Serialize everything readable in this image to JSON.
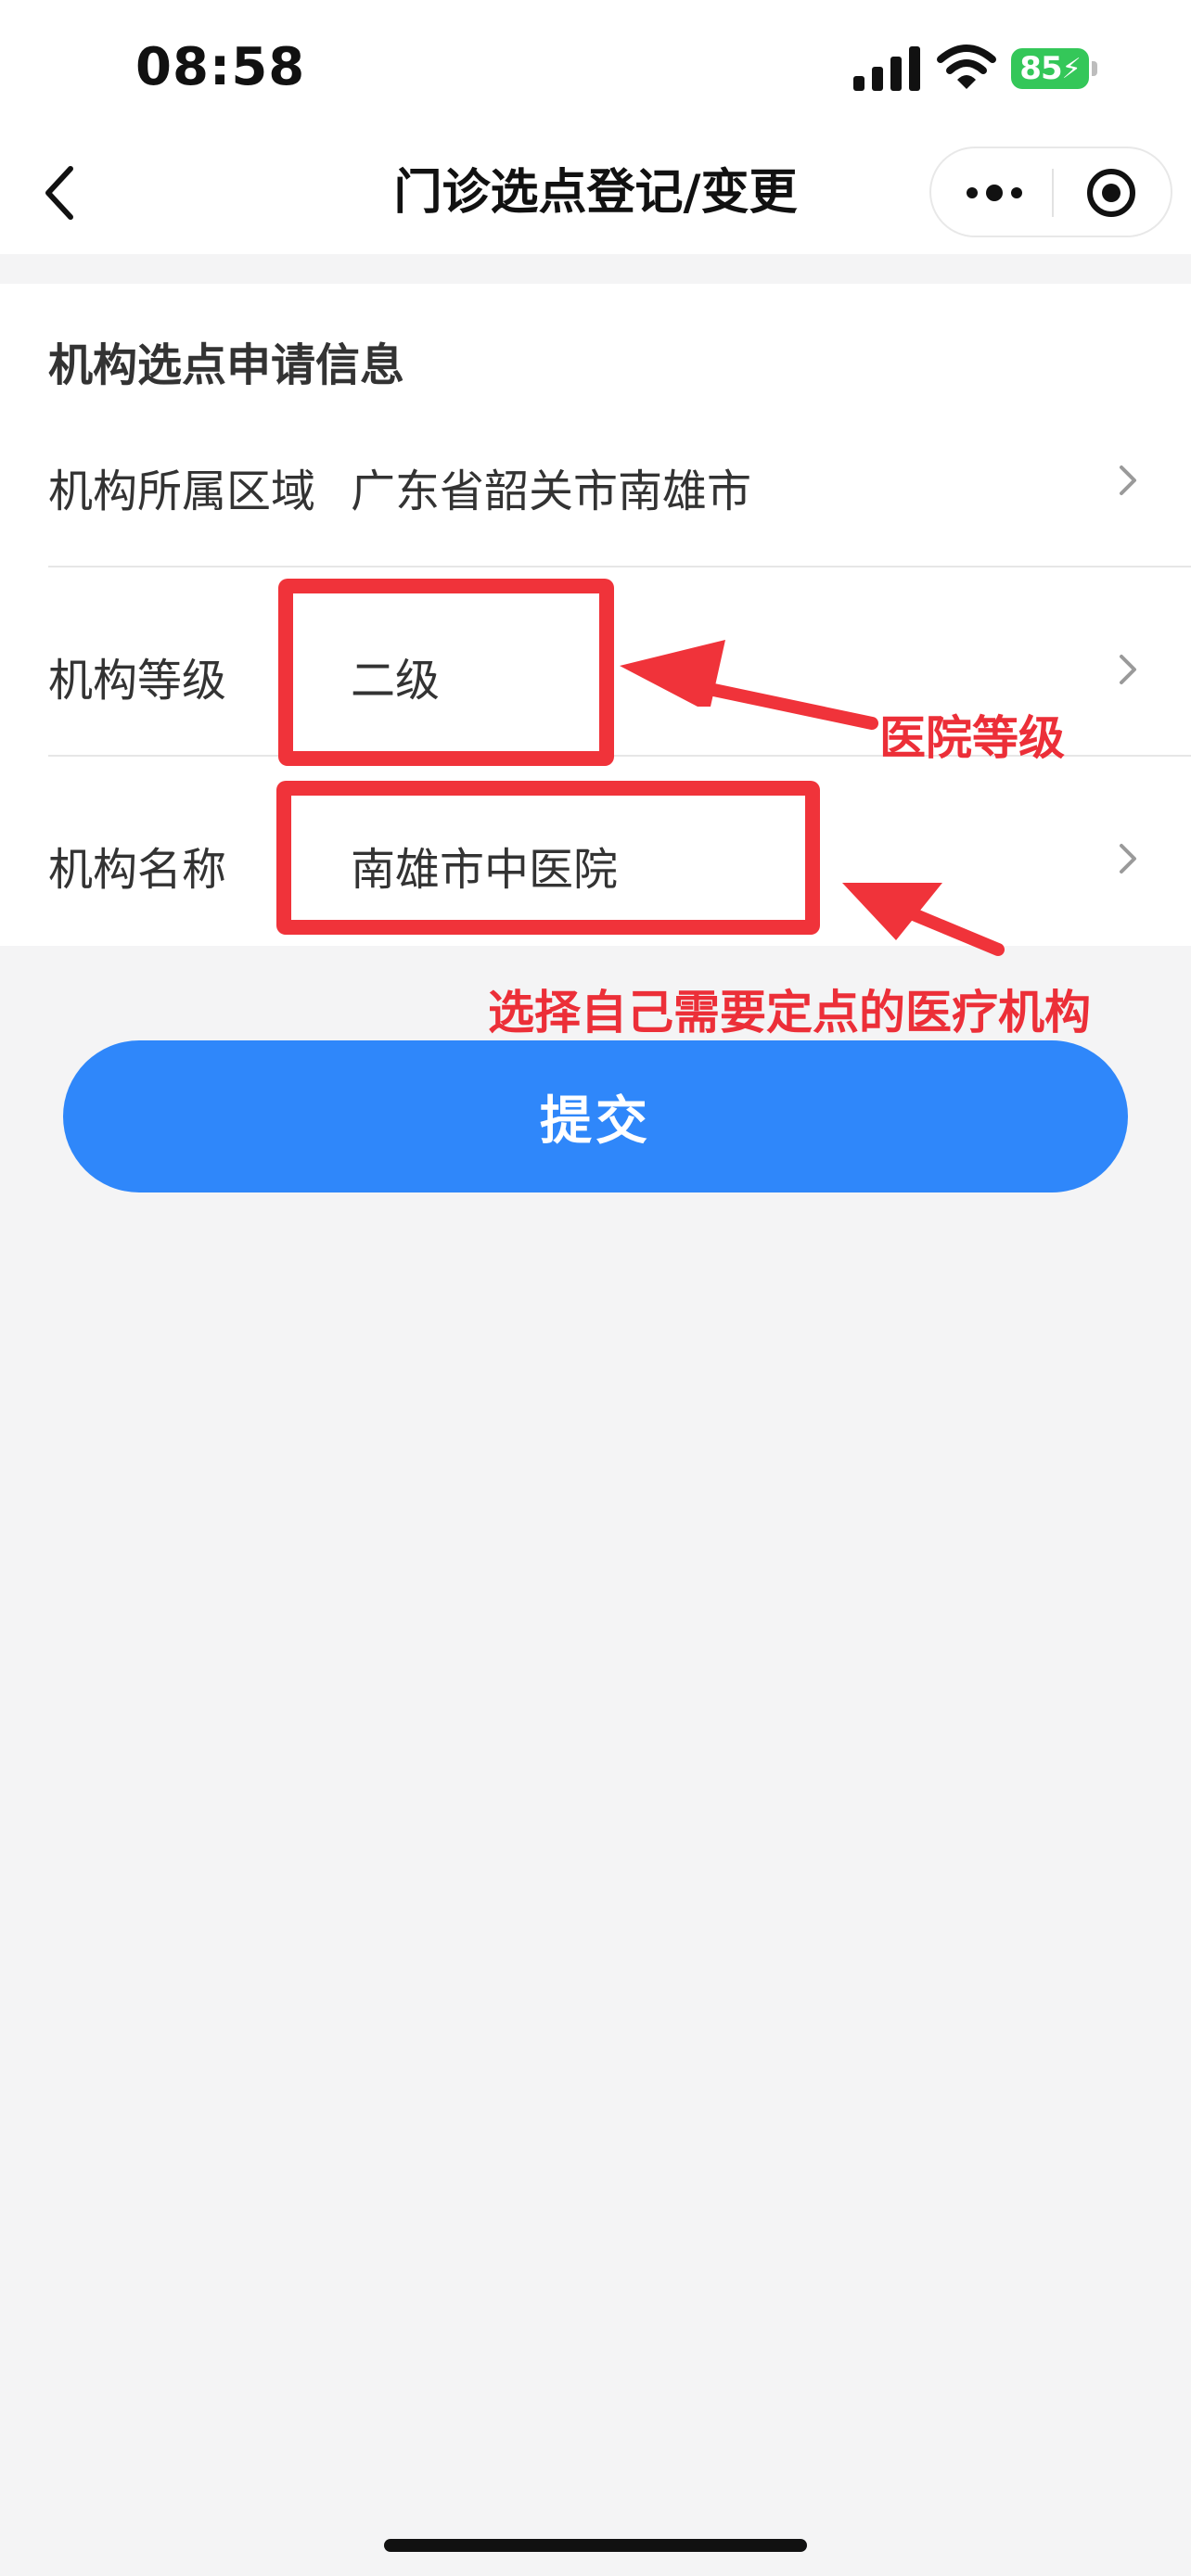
{
  "status_bar": {
    "time": "08:58",
    "battery": "85",
    "icons": [
      "signal-icon",
      "wifi-icon",
      "battery-icon"
    ]
  },
  "nav": {
    "title": "门诊选点登记/变更",
    "icons": [
      "back-icon",
      "more-icon",
      "target-icon"
    ]
  },
  "form": {
    "section_title": "机构选点申请信息",
    "fields": [
      {
        "label": "机构所属区域",
        "value": "广东省韶关市南雄市"
      },
      {
        "label": "机构等级",
        "value": "二级"
      },
      {
        "label": "机构名称",
        "value": "南雄市中医院"
      }
    ]
  },
  "annotations": {
    "level_note": "医院等级",
    "name_note": "选择自己需要定点的医疗机构",
    "color": "#f0333a"
  },
  "submit": {
    "label": "提交",
    "color": "#2f87fa"
  }
}
